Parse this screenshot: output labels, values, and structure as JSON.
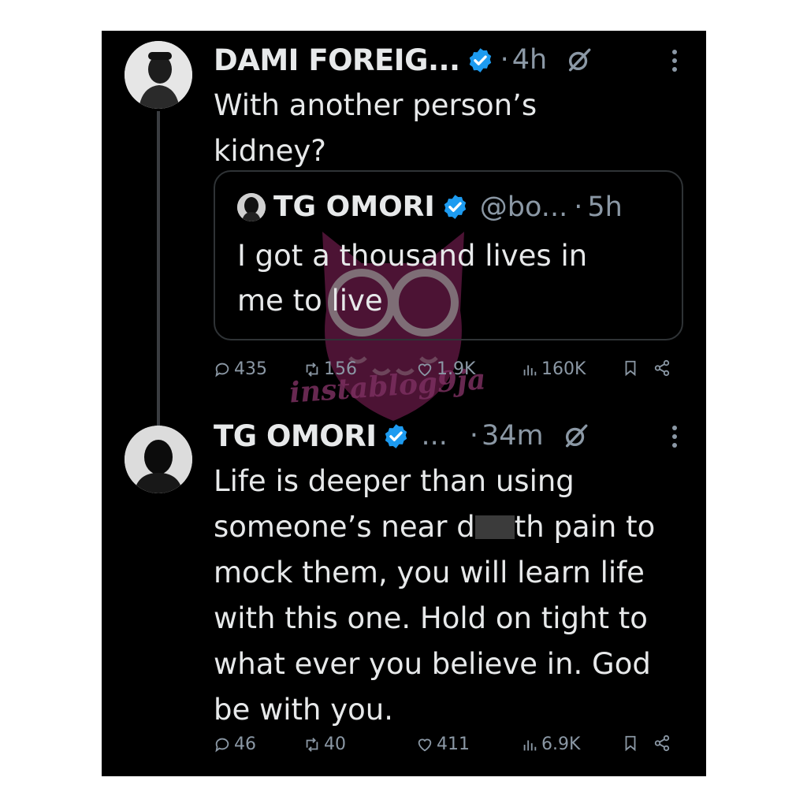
{
  "tweets": [
    {
      "author": "DAMI FOREIG...",
      "separator": "·",
      "time": "4h",
      "body_lines": [
        "With another person’s",
        "kidney?"
      ],
      "stats": {
        "replies": "435",
        "reposts": "156",
        "likes": "1.9K",
        "views": "160K"
      }
    },
    {
      "author": "TG OMORI",
      "ellipsis": "...",
      "separator": "·",
      "time": "34m",
      "body_lines": [
        "Life is deeper than using",
        "someone’s near d",
        "th pain to",
        "mock them, you will learn life",
        "with this one. Hold on tight to",
        "what ever you believe in. God",
        "be with you."
      ],
      "stats": {
        "replies": "46",
        "reposts": "40",
        "likes": "411",
        "views": "6.9K"
      }
    }
  ],
  "quoted": {
    "author": "TG OMORI",
    "handle": "@bo...",
    "separator": "·",
    "time": "5h",
    "body_lines": [
      "I got a thousand lives in",
      "me to live"
    ]
  },
  "watermark": {
    "text": "instablog9ja",
    "color": "#e0308a"
  },
  "colors": {
    "background": "#000000",
    "text": "#e7e9ea",
    "muted": "#8b98a5",
    "verified": "#1d9bf0",
    "border": "#2f3336"
  },
  "icons": [
    "verified-badge-icon",
    "grok-icon",
    "more-icon",
    "reply-icon",
    "repost-icon",
    "like-icon",
    "views-icon",
    "bookmark-icon",
    "share-icon"
  ]
}
